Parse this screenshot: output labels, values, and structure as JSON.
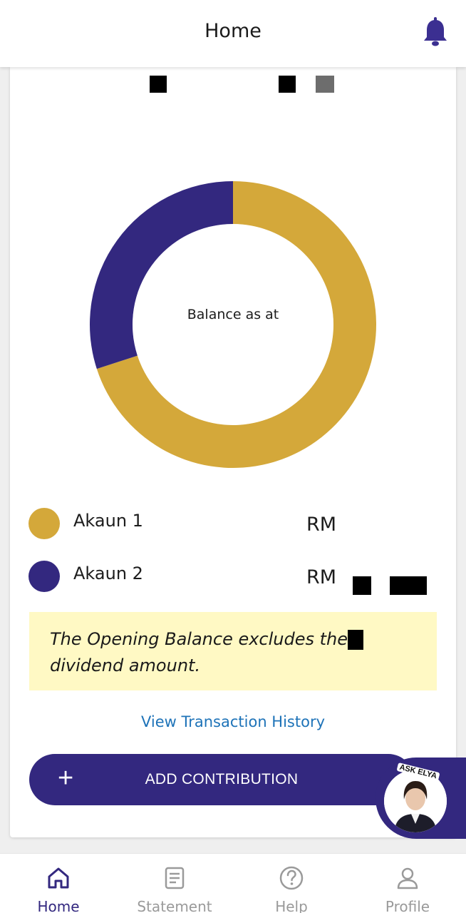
{
  "header": {
    "title": "Home",
    "notification_icon": "bell-icon"
  },
  "balance_chart": {
    "center_label": "Balance as at",
    "chart_data": {
      "type": "pie",
      "categories": [
        "Akaun 1",
        "Akaun 2"
      ],
      "values": [
        70,
        30
      ],
      "colors": [
        "#d4a83a",
        "#33287f"
      ],
      "style": "donut"
    }
  },
  "accounts": [
    {
      "label": "Akaun 1",
      "currency": "RM",
      "color": "#d4a83a"
    },
    {
      "label": "Akaun 2",
      "currency": "RM",
      "color": "#33287f"
    }
  ],
  "notice": {
    "line1": "The Opening Balance excludes the",
    "line2": "dividend amount."
  },
  "links": {
    "view_history": "View Transaction History"
  },
  "actions": {
    "add_contribution": "ADD CONTRIBUTION",
    "add_icon": "plus-icon"
  },
  "assistant": {
    "label": "ASK ELYA"
  },
  "nav": [
    {
      "label": "Home",
      "icon": "home-icon",
      "active": true
    },
    {
      "label": "Statement",
      "icon": "document-icon",
      "active": false
    },
    {
      "label": "Help",
      "icon": "help-icon",
      "active": false
    },
    {
      "label": "Profile",
      "icon": "user-icon",
      "active": false
    }
  ],
  "colors": {
    "brand": "#33287f",
    "accent": "#d4a83a",
    "link": "#1e73b8",
    "notice_bg": "#fff9c4"
  }
}
